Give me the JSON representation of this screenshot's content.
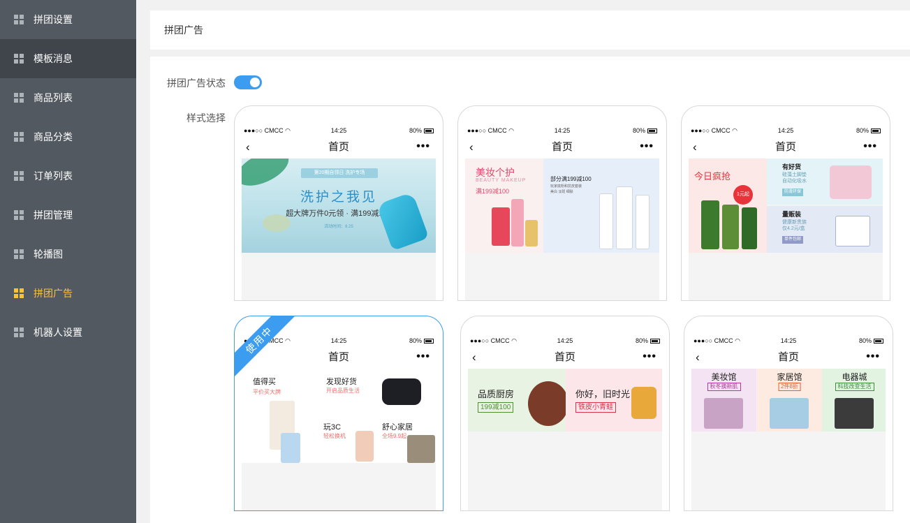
{
  "sidebar": {
    "items": [
      {
        "label": "拼团设置"
      },
      {
        "label": "模板消息"
      },
      {
        "label": "商品列表"
      },
      {
        "label": "商品分类"
      },
      {
        "label": "订单列表"
      },
      {
        "label": "拼团管理"
      },
      {
        "label": "轮播图"
      },
      {
        "label": "拼团广告"
      },
      {
        "label": "机器人设置"
      }
    ],
    "current_color": "#f7c33b"
  },
  "header": {
    "title": "拼团广告"
  },
  "main": {
    "status_label": "拼团广告状态",
    "status_enabled": true,
    "style_label": "样式选择",
    "selected_badge": "使用中",
    "accent_color": "#3c9cf0"
  },
  "phone": {
    "carrier": "●●●○○ CMCC ◠",
    "time": "14:25",
    "battery": "80%",
    "back": "‹",
    "title": "首页",
    "more": "•••"
  },
  "banners": {
    "b1": {
      "tag": "第20期自领日 洗护专场",
      "headline": "洗护之我见",
      "sub": "超大牌万件0元领 · 满199减100",
      "date": "活动时间：8.25"
    },
    "b2": {
      "left_title": "美妆个护",
      "left_en": "BEAUTY MAKEUP",
      "left_promo": "满199减100",
      "right_promo": "部分满199减100",
      "right_line1": "玩家底粉和抗皮套装",
      "right_line2": "美白  淡斑  细肤"
    },
    "b3": {
      "left_title": "今日疯抢",
      "left_pill": "1元起",
      "tr_title": "有好货",
      "tr_line1": "硅藻土脚垫",
      "tr_line2": "自动化吸水",
      "tr_tag": "防滑环保",
      "br_title": "量贩装",
      "br_line1": "健康新贵族",
      "br_line2": "仅4.2元/盒",
      "br_tag": "单件包邮"
    },
    "b4": {
      "c1_title": "值得买",
      "c1_sub": "平价买大牌",
      "c2_title": "发现好货",
      "c2_sub": "开启品质生活",
      "c3_title": "玩3C",
      "c3_sub": "轻松换机",
      "c4_title": "舒心家居",
      "c4_sub": "全场9.9起"
    },
    "b5": {
      "left_title": "品质厨房",
      "left_tag": "199减100",
      "right_title": "你好，旧时光",
      "right_tag": "铁皮小青蛙"
    },
    "b6": {
      "c1_title": "美妆馆",
      "c1_tag": "秋冬换新肌",
      "c2_title": "家居馆",
      "c2_tag": "2件8折",
      "c3_title": "电器城",
      "c3_tag": "科技改变生活"
    }
  }
}
